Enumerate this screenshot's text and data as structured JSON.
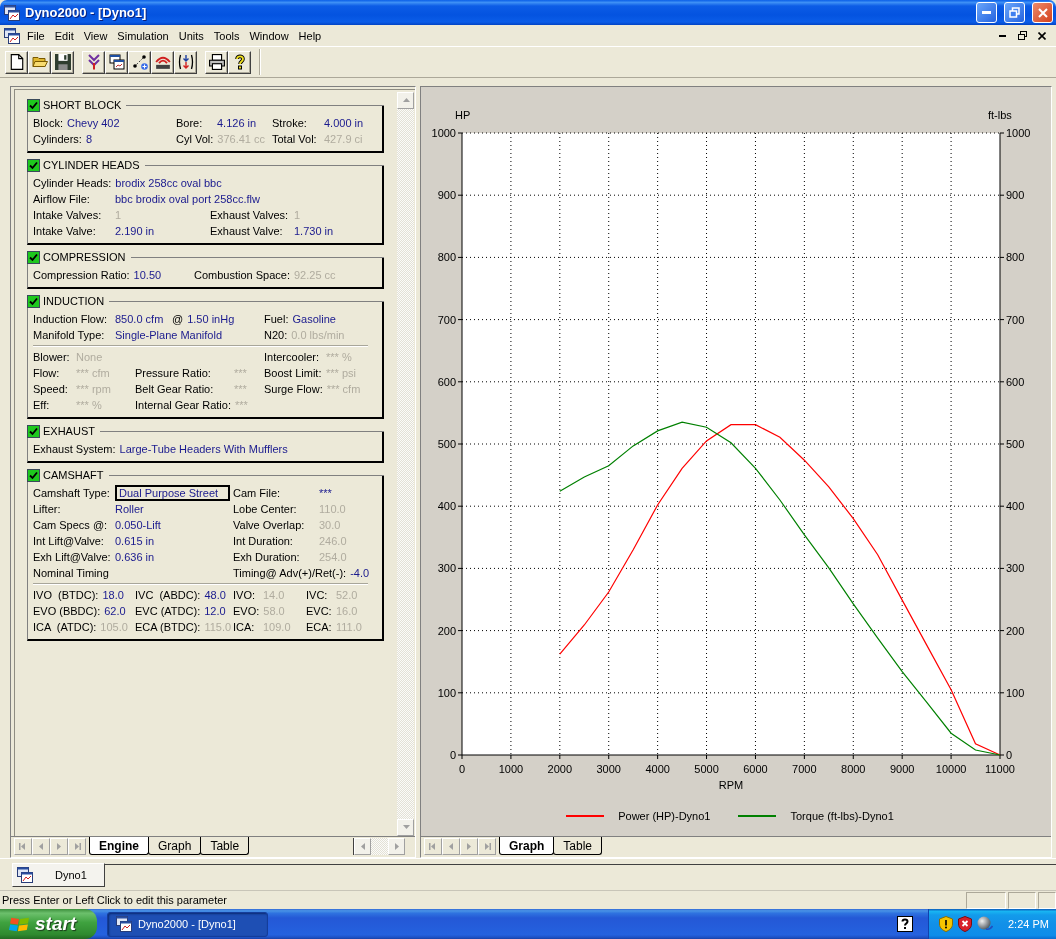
{
  "window": {
    "title": "Dyno2000 - [Dyno1]"
  },
  "menu": {
    "items": [
      "File",
      "Edit",
      "View",
      "Simulation",
      "Units",
      "Tools",
      "Window",
      "Help"
    ]
  },
  "engine_panel": {
    "sections": [
      {
        "title": "SHORT BLOCK",
        "checked": true,
        "groups": [
          {
            "rows": [
              {
                "kind": "grid",
                "fields": [
                  {
                    "label": "Block:",
                    "value": "Chevy 402",
                    "dim": false,
                    "focused": false
                  },
                  {
                    "label": "Bore:",
                    "value": "4.126 in",
                    "dim": false,
                    "focused": false
                  },
                  {
                    "label": "Stroke:",
                    "value": "4.000 in",
                    "dim": false,
                    "focused": false
                  }
                ]
              },
              {
                "kind": "grid",
                "fields": [
                  {
                    "label": "Cylinders:",
                    "value": "8",
                    "dim": false,
                    "focused": false
                  },
                  {
                    "label": "Cyl Vol:",
                    "value": "376.41 cc",
                    "dim": true,
                    "focused": false
                  },
                  {
                    "label": "Total Vol:",
                    "value": "427.9 ci",
                    "dim": true,
                    "focused": false
                  }
                ]
              }
            ]
          }
        ]
      },
      {
        "title": "CYLINDER HEADS",
        "checked": true,
        "groups": [
          {
            "rows": [
              {
                "kind": "grid",
                "fields": [
                  {
                    "label": "Cylinder Heads:",
                    "value": "brodix 258cc oval bbc",
                    "dim": false,
                    "focused": false
                  }
                ]
              },
              {
                "kind": "grid",
                "fields": [
                  {
                    "label": "Airflow File:",
                    "value": "bbc brodix oval port 258cc.flw",
                    "dim": false,
                    "focused": false
                  }
                ]
              },
              {
                "kind": "grid",
                "fields": [
                  {
                    "label": "Intake Valves:",
                    "value": "1",
                    "dim": true,
                    "focused": false
                  },
                  {
                    "label": "Exhaust Valves:",
                    "value": "1",
                    "dim": true,
                    "focused": false
                  }
                ]
              },
              {
                "kind": "grid",
                "fields": [
                  {
                    "label": "Intake Valve:",
                    "value": "2.190 in",
                    "dim": false,
                    "focused": false
                  },
                  {
                    "label": "Exhaust Valve:",
                    "value": "1.730 in",
                    "dim": false,
                    "focused": false
                  }
                ]
              }
            ]
          }
        ]
      },
      {
        "title": "COMPRESSION",
        "checked": true,
        "groups": [
          {
            "rows": [
              {
                "kind": "grid",
                "fields": [
                  {
                    "label": "Compression Ratio:",
                    "value": "10.50",
                    "dim": false,
                    "focused": false
                  },
                  {
                    "label": "Combustion Space:",
                    "value": "92.25 cc",
                    "dim": true,
                    "focused": false
                  }
                ]
              }
            ]
          }
        ]
      },
      {
        "title": "INDUCTION",
        "checked": true,
        "groups": [
          {
            "rows": [
              {
                "kind": "grid",
                "fields": [
                  {
                    "label": "Induction Flow:",
                    "value": "850.0 cfm",
                    "dim": false,
                    "focused": false
                  },
                  {
                    "label": "@",
                    "value": "1.50 inHg",
                    "dim": false,
                    "focused": false
                  },
                  {
                    "label": "Fuel:",
                    "value": "Gasoline",
                    "dim": false,
                    "focused": false
                  }
                ]
              },
              {
                "kind": "split",
                "fields": [
                  {
                    "label": "Manifold Type:",
                    "value": "Single-Plane Manifold",
                    "dim": false,
                    "focused": false
                  },
                  {
                    "label": "N20:",
                    "value": "0.0 lbs/min",
                    "dim": true,
                    "focused": false
                  }
                ]
              }
            ]
          },
          {
            "rows": [
              {
                "kind": "split",
                "fields": [
                  {
                    "label": "Blower:",
                    "value": "None",
                    "dim": true,
                    "focused": false
                  },
                  {
                    "label": "Intercooler:",
                    "value": "*** %",
                    "dim": true,
                    "focused": false
                  }
                ]
              },
              {
                "kind": "grid",
                "fields": [
                  {
                    "label": "Flow:",
                    "value": "*** cfm",
                    "dim": true,
                    "focused": false
                  },
                  {
                    "label": "Pressure Ratio:",
                    "value": "***",
                    "dim": true,
                    "focused": false
                  },
                  {
                    "label": "Boost Limit:",
                    "value": "*** psi",
                    "dim": true,
                    "focused": false
                  }
                ]
              },
              {
                "kind": "grid",
                "fields": [
                  {
                    "label": "Speed:",
                    "value": "*** rpm",
                    "dim": true,
                    "focused": false
                  },
                  {
                    "label": "Belt Gear Ratio:",
                    "value": "***",
                    "dim": true,
                    "focused": false
                  },
                  {
                    "label": "Surge Flow:",
                    "value": "*** cfm",
                    "dim": true,
                    "focused": false
                  }
                ]
              },
              {
                "kind": "grid",
                "fields": [
                  {
                    "label": "Eff:",
                    "value": "*** %",
                    "dim": true,
                    "focused": false
                  },
                  {
                    "label": "Internal Gear Ratio:",
                    "value": "***",
                    "dim": true,
                    "focused": false
                  }
                ]
              }
            ]
          }
        ]
      },
      {
        "title": "EXHAUST",
        "checked": true,
        "groups": [
          {
            "rows": [
              {
                "kind": "grid",
                "fields": [
                  {
                    "label": "Exhaust System:",
                    "value": "Large-Tube Headers With Mufflers",
                    "dim": false,
                    "focused": false
                  }
                ]
              }
            ]
          }
        ]
      },
      {
        "title": "CAMSHAFT",
        "checked": true,
        "groups": [
          {
            "rows": [
              {
                "kind": "grid",
                "fields": [
                  {
                    "label": "Camshaft Type:",
                    "value": "Dual Purpose Street",
                    "dim": false,
                    "focused": true
                  },
                  {
                    "label": "Cam File:",
                    "value": "***",
                    "dim": false,
                    "focused": false
                  }
                ]
              },
              {
                "kind": "grid",
                "fields": [
                  {
                    "label": "Lifter:",
                    "value": "Roller",
                    "dim": false,
                    "focused": false
                  },
                  {
                    "label": "Lobe Center:",
                    "value": "110.0",
                    "dim": true,
                    "focused": false
                  }
                ]
              },
              {
                "kind": "grid",
                "fields": [
                  {
                    "label": "Cam Specs @:",
                    "value": "0.050-Lift",
                    "dim": false,
                    "focused": false
                  },
                  {
                    "label": "Valve Overlap:",
                    "value": "30.0",
                    "dim": true,
                    "focused": false
                  }
                ]
              },
              {
                "kind": "grid",
                "fields": [
                  {
                    "label": "Int Lift@Valve:",
                    "value": "0.615 in",
                    "dim": false,
                    "focused": false
                  },
                  {
                    "label": "Int Duration:",
                    "value": "246.0",
                    "dim": true,
                    "focused": false
                  }
                ]
              },
              {
                "kind": "grid",
                "fields": [
                  {
                    "label": "Exh Lift@Valve:",
                    "value": "0.636 in",
                    "dim": false,
                    "focused": false
                  },
                  {
                    "label": "Exh Duration:",
                    "value": "254.0",
                    "dim": true,
                    "focused": false
                  }
                ]
              },
              {
                "kind": "grid",
                "fields": [
                  {
                    "label": "Nominal Timing"
                  },
                  {
                    "label": "Timing@ Adv(+)/Ret(-):",
                    "value": "-4.0",
                    "dim": false,
                    "focused": false
                  }
                ]
              }
            ]
          },
          {
            "rows": [
              {
                "kind": "grid",
                "fields": [
                  {
                    "label": "IVO  (BTDC):",
                    "value": "18.0",
                    "dim": false,
                    "focused": false
                  },
                  {
                    "label": "IVC  (ABDC):",
                    "value": "48.0",
                    "dim": false,
                    "focused": false
                  },
                  {
                    "label": "IVO:",
                    "value": "14.0",
                    "dim": true,
                    "focused": false
                  },
                  {
                    "label": "IVC:",
                    "value": "52.0",
                    "dim": true,
                    "focused": false
                  }
                ]
              },
              {
                "kind": "grid",
                "fields": [
                  {
                    "label": "EVO (BBDC):",
                    "value": "62.0",
                    "dim": false,
                    "focused": false
                  },
                  {
                    "label": "EVC (ATDC):",
                    "value": "12.0",
                    "dim": false,
                    "focused": false
                  },
                  {
                    "label": "EVO:",
                    "value": "58.0",
                    "dim": true,
                    "focused": false
                  },
                  {
                    "label": "EVC:",
                    "value": "16.0",
                    "dim": true,
                    "focused": false
                  }
                ]
              },
              {
                "kind": "grid",
                "fields": [
                  {
                    "label": "ICA  (ATDC):",
                    "value": "105.0",
                    "dim": true,
                    "focused": false
                  },
                  {
                    "label": "ECA (BTDC):",
                    "value": "115.0",
                    "dim": true,
                    "focused": false
                  },
                  {
                    "label": "ICA:",
                    "value": "109.0",
                    "dim": true,
                    "focused": false
                  },
                  {
                    "label": "ECA:",
                    "value": "111.0",
                    "dim": true,
                    "focused": false
                  }
                ]
              }
            ]
          }
        ]
      }
    ],
    "tabs": [
      {
        "label": "Engine",
        "selected": true
      },
      {
        "label": "Graph",
        "selected": false
      },
      {
        "label": "Table",
        "selected": false
      }
    ]
  },
  "graph_panel": {
    "chart_data": {
      "type": "line",
      "xlabel": "RPM",
      "ylabel": "HP",
      "x": [
        2000,
        2500,
        3000,
        3500,
        4000,
        4500,
        5000,
        5500,
        6000,
        6500,
        7000,
        7500,
        8000,
        8500,
        9000,
        9500,
        10000,
        10500,
        11000
      ],
      "series": [
        {
          "name": "Power (HP)-Dyno1",
          "color": "#ff0000",
          "values": [
            162,
            209,
            262,
            330,
            402,
            461,
            505,
            531,
            531,
            511,
            474,
            431,
            380,
            322,
            249,
            177,
            105,
            18,
            0
          ]
        },
        {
          "name": "Torque (ft-lbs)-Dyno1",
          "color": "#008000",
          "values": [
            424,
            447,
            465,
            497,
            521,
            535,
            527,
            502,
            461,
            410,
            354,
            301,
            243,
            188,
            134,
            85,
            35,
            8,
            0
          ]
        }
      ],
      "xlim": [
        0,
        11000
      ],
      "ylim": [
        0,
        1000
      ],
      "xticks": [
        0,
        1000,
        2000,
        3000,
        4000,
        5000,
        6000,
        7000,
        8000,
        9000,
        10000,
        11000
      ],
      "yticks": [
        0,
        100,
        200,
        300,
        400,
        500,
        600,
        700,
        800,
        900,
        1000
      ],
      "grid": true
    },
    "right_axis": {
      "title": "ft-lbs",
      "ticks": [
        "1000",
        "900",
        "800",
        "700",
        "600",
        "500",
        "400",
        "300",
        "200",
        "100",
        "0"
      ]
    },
    "tabs": [
      {
        "label": "Graph",
        "selected": true
      },
      {
        "label": "Table",
        "selected": false
      }
    ]
  },
  "document_tabs": [
    {
      "label": "Dyno1",
      "selected": true
    }
  ],
  "status_bar": {
    "text": "Press Enter or Left Click to edit this parameter"
  },
  "taskbar": {
    "start_label": "start",
    "tasks": [
      {
        "label": "Dyno2000 - [Dyno1]",
        "selected": true
      }
    ],
    "clock": "2:24 PM"
  }
}
